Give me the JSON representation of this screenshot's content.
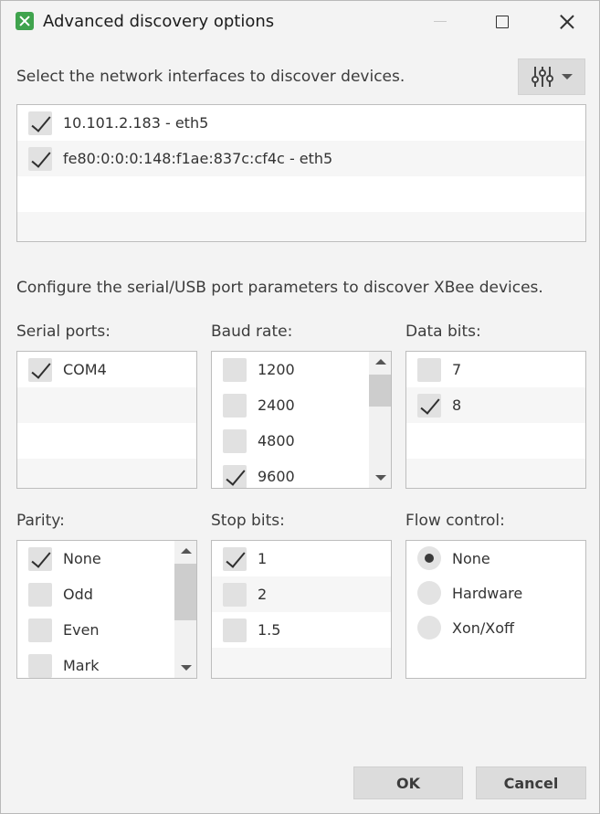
{
  "window": {
    "title": "Advanced discovery options"
  },
  "network": {
    "prompt": "Select the network interfaces to discover devices.",
    "filter_icon": "sliders-icon",
    "interfaces": [
      {
        "label": "10.101.2.183 - eth5",
        "checked": true
      },
      {
        "label": "fe80:0:0:0:148:f1ae:837c:cf4c - eth5",
        "checked": true
      }
    ]
  },
  "serial": {
    "prompt": "Configure the serial/USB port parameters to discover XBee devices.",
    "ports": {
      "label": "Serial ports:",
      "items": [
        {
          "label": "COM4",
          "checked": true
        }
      ]
    },
    "baud": {
      "label": "Baud rate:",
      "items": [
        {
          "label": "1200",
          "checked": false
        },
        {
          "label": "2400",
          "checked": false
        },
        {
          "label": "4800",
          "checked": false
        },
        {
          "label": "9600",
          "checked": true
        }
      ]
    },
    "data_bits": {
      "label": "Data bits:",
      "items": [
        {
          "label": "7",
          "checked": false
        },
        {
          "label": "8",
          "checked": true
        }
      ]
    },
    "parity": {
      "label": "Parity:",
      "items": [
        {
          "label": "None",
          "checked": true
        },
        {
          "label": "Odd",
          "checked": false
        },
        {
          "label": "Even",
          "checked": false
        },
        {
          "label": "Mark",
          "checked": false
        }
      ]
    },
    "stop_bits": {
      "label": "Stop bits:",
      "items": [
        {
          "label": "1",
          "checked": true
        },
        {
          "label": "2",
          "checked": false
        },
        {
          "label": "1.5",
          "checked": false
        }
      ]
    },
    "flow_control": {
      "label": "Flow control:",
      "items": [
        {
          "label": "None",
          "selected": true
        },
        {
          "label": "Hardware",
          "selected": false
        },
        {
          "label": "Xon/Xoff",
          "selected": false
        }
      ]
    }
  },
  "buttons": {
    "ok": "OK",
    "cancel": "Cancel"
  }
}
